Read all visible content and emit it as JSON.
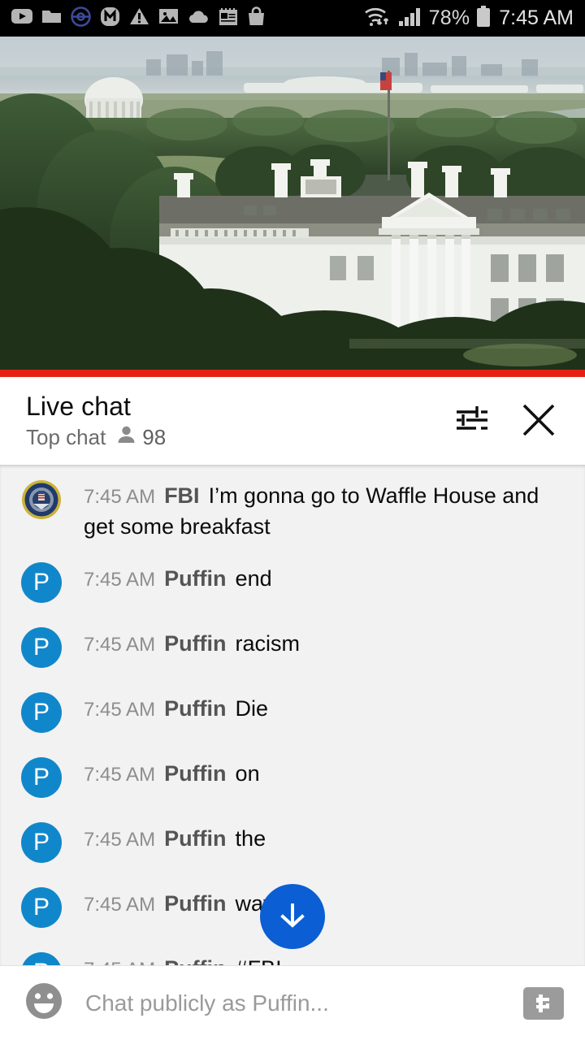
{
  "statusbar": {
    "icons": [
      {
        "name": "youtube-icon"
      },
      {
        "name": "folder-icon"
      },
      {
        "name": "pokeball-icon"
      },
      {
        "name": "messenger-m-icon"
      },
      {
        "name": "warning-triangle-icon"
      },
      {
        "name": "photo-image-icon"
      },
      {
        "name": "cloud-icon"
      },
      {
        "name": "notepad-icon"
      },
      {
        "name": "shopping-bag-icon"
      }
    ],
    "wifi_icon": "wifi-transfer-icon",
    "signal_icon": "cellular-signal-icon",
    "battery_percent": "78%",
    "battery_icon": "battery-icon",
    "time": "7:45 AM"
  },
  "video": {
    "name": "white-house-live-stream",
    "progress_color": "#e52117",
    "is_live": true
  },
  "chat_header": {
    "title": "Live chat",
    "subtitle": "Top chat",
    "viewer_icon": "person-icon",
    "viewer_count": "98",
    "settings_icon": "chat-settings-sliders-icon",
    "close_icon": "close-x-icon"
  },
  "messages": [
    {
      "avatar_type": "fbi-seal",
      "avatar_letter": "",
      "time": "7:45 AM",
      "author": "FBI",
      "text": "I’m gonna go to Waffle House and get some breakfast"
    },
    {
      "avatar_type": "letter",
      "avatar_letter": "P",
      "time": "7:45 AM",
      "author": "Puffin",
      "text": "end"
    },
    {
      "avatar_type": "letter",
      "avatar_letter": "P",
      "time": "7:45 AM",
      "author": "Puffin",
      "text": "racism"
    },
    {
      "avatar_type": "letter",
      "avatar_letter": "P",
      "time": "7:45 AM",
      "author": "Puffin",
      "text": "Die"
    },
    {
      "avatar_type": "letter",
      "avatar_letter": "P",
      "time": "7:45 AM",
      "author": "Puffin",
      "text": "on"
    },
    {
      "avatar_type": "letter",
      "avatar_letter": "P",
      "time": "7:45 AM",
      "author": "Puffin",
      "text": "the"
    },
    {
      "avatar_type": "letter",
      "avatar_letter": "P",
      "time": "7:45 AM",
      "author": "Puffin",
      "text": "way"
    },
    {
      "avatar_type": "letter",
      "avatar_letter": "P",
      "time": "7:45 AM",
      "author": "Puffin",
      "text": "#FBI"
    }
  ],
  "scroll_fab": {
    "icon": "arrow-down-icon",
    "color": "#0b5ed3"
  },
  "composer": {
    "emoji_icon": "emoji-smiley-icon",
    "placeholder": "Chat publicly as Puffin...",
    "value": "",
    "superchat_icon": "dollar-superchat-icon"
  },
  "colors": {
    "accent_blue": "#0b5ed3",
    "avatar_blue": "#1187cb",
    "live_red": "#e52117",
    "chat_bg": "#f2f2f2"
  }
}
